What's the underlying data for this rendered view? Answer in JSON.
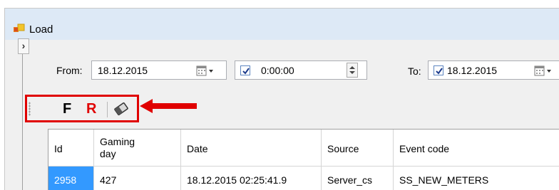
{
  "window": {
    "title": "Load"
  },
  "filter": {
    "from_label": "From:",
    "from_date": "18.12.2015",
    "from_time_checked": true,
    "from_time": "0:00:00",
    "to_label": "To:",
    "to_date_checked": true,
    "to_date": "18.12.2015"
  },
  "toolbar": {
    "f_label": "F",
    "r_label": "R",
    "highlight_color": "#e00000",
    "eraser_icon": "eraser-icon"
  },
  "grid": {
    "columns": [
      {
        "line1": "Id",
        "line2": ""
      },
      {
        "line1": "Gaming",
        "line2": "day"
      },
      {
        "line1": "Date",
        "line2": ""
      },
      {
        "line1": "Source",
        "line2": ""
      },
      {
        "line1": "Event code",
        "line2": ""
      }
    ],
    "rows": [
      [
        "2958",
        "427",
        "18.12.2015 02:25:41.9",
        "Server_cs",
        "SS_NEW_METERS"
      ]
    ]
  },
  "colors": {
    "selection": "#3399ff",
    "titlebar": "#dde9f6",
    "annotation": "#e00000"
  }
}
